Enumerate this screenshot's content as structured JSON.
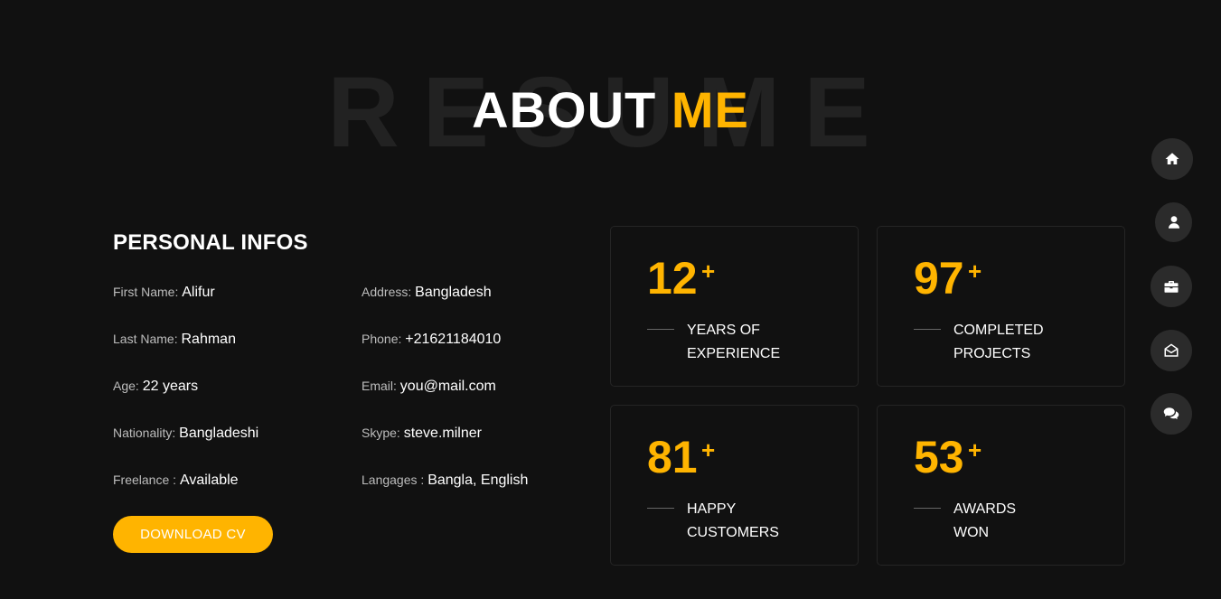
{
  "section": {
    "background_word": "RESUME",
    "title_part1": "ABOUT",
    "title_part2": "ME"
  },
  "personal": {
    "heading": "PERSONAL INFOS",
    "items": [
      {
        "label": "First Name:",
        "value": "Alifur"
      },
      {
        "label": "Address:",
        "value": "Bangladesh"
      },
      {
        "label": "Last Name:",
        "value": "Rahman"
      },
      {
        "label": "Phone:",
        "value": "+21621184010"
      },
      {
        "label": "Age:",
        "value": "22 years"
      },
      {
        "label": "Email:",
        "value": "you@mail.com"
      },
      {
        "label": "Nationality:",
        "value": "Bangladeshi"
      },
      {
        "label": "Skype:",
        "value": "steve.milner"
      },
      {
        "label": "Freelance :",
        "value": "Available"
      },
      {
        "label": "Langages :",
        "value": "Bangla, English"
      }
    ],
    "download_label": "DOWNLOAD CV"
  },
  "stats": [
    {
      "number": "12",
      "plus": "+",
      "label_line1": "YEARS OF",
      "label_line2": "EXPERIENCE"
    },
    {
      "number": "97",
      "plus": "+",
      "label_line1": "COMPLETED",
      "label_line2": "PROJECTS"
    },
    {
      "number": "81",
      "plus": "+",
      "label_line1": "HAPPY",
      "label_line2": "CUSTOMERS"
    },
    {
      "number": "53",
      "plus": "+",
      "label_line1": "AWARDS",
      "label_line2": "WON"
    }
  ],
  "nav": [
    {
      "icon": "home-icon"
    },
    {
      "icon": "user-icon"
    },
    {
      "icon": "briefcase-icon"
    },
    {
      "icon": "envelope-open-icon"
    },
    {
      "icon": "comments-icon"
    }
  ],
  "colors": {
    "background": "#111111",
    "accent": "#ffb400",
    "nav_button": "#2b2b2b"
  }
}
